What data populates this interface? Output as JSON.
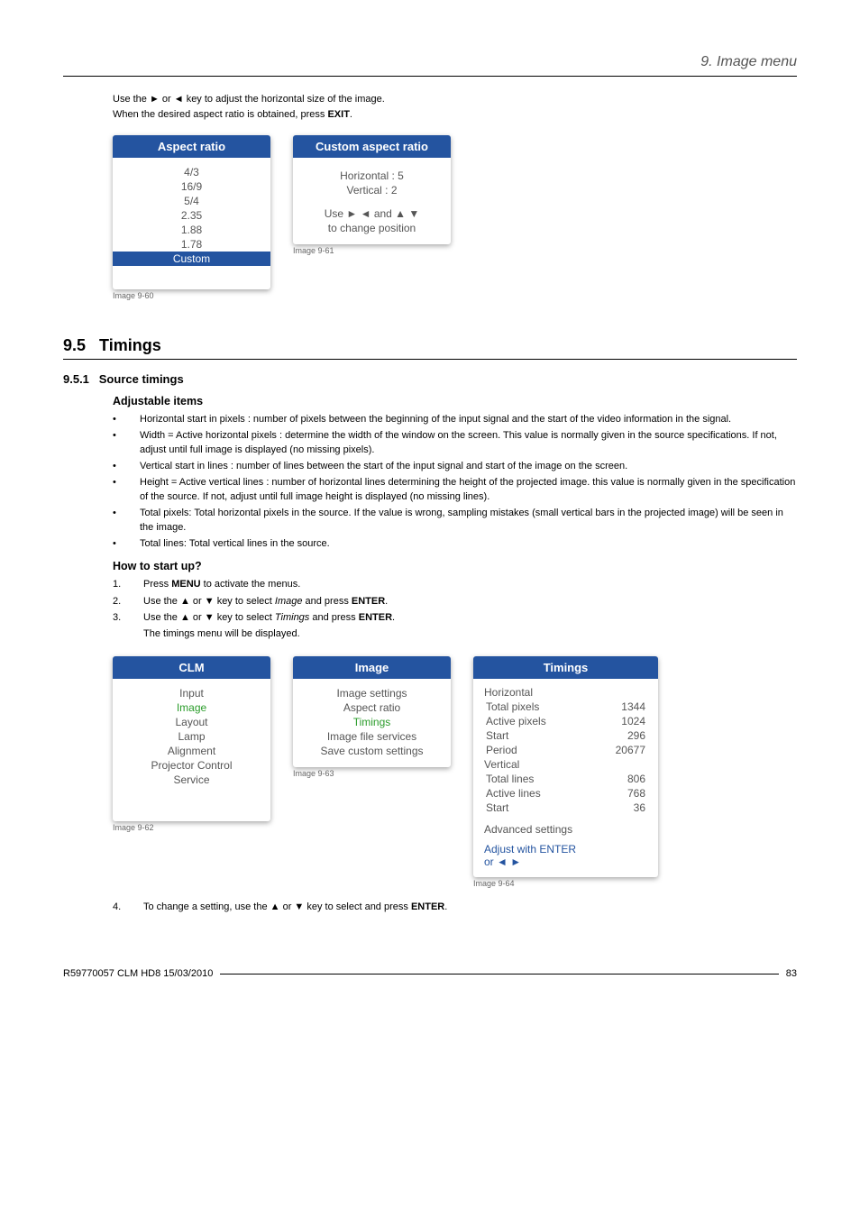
{
  "chapter": "9. Image menu",
  "intro": {
    "line1_pre": "Use the ► or ◄ key to adjust the horizontal size of the image.",
    "line2_pre": "When the desired aspect ratio is obtained, press ",
    "line2_bold": "EXIT",
    "line2_post": "."
  },
  "aspect_box": {
    "title": "Aspect ratio",
    "items": [
      "4/3",
      "16/9",
      "5/4",
      "2.35",
      "1.88",
      "1.78"
    ],
    "selected": "Custom",
    "caption": "Image 9-60"
  },
  "custom_box": {
    "title": "Custom aspect ratio",
    "h_label": "Horizontal : 5",
    "v_label": "Vertical : 2",
    "hint1": "Use ► ◄ and ▲ ▼",
    "hint2": "to change position",
    "caption": "Image 9-61"
  },
  "section_num": "9.5",
  "section_title": "Timings",
  "subsection_num": "9.5.1",
  "subsection_title": "Source timings",
  "adj_heading": "Adjustable items",
  "adj_items": [
    "Horizontal start in pixels : number of pixels between the beginning of the input signal and the start of the video information in the signal.",
    "Width = Active horizontal pixels : determine the width of the window on the screen. This value is normally given in the source specifications. If not, adjust until full image is displayed (no missing pixels).",
    "Vertical start in lines : number of lines between the start of the input signal and start of the image on the screen.",
    "Height = Active vertical lines : number of horizontal lines determining the height of the projected image. this value is normally given in the specification of the source. If not, adjust until full image height is displayed (no missing lines).",
    "Total pixels: Total horizontal pixels in the source. If the value is wrong, sampling mistakes (small vertical bars in the projected image) will be seen in the image.",
    "Total lines: Total vertical lines in the source."
  ],
  "how_heading": "How to start up?",
  "steps": {
    "s1_pre": "Press ",
    "s1_b1": "MENU",
    "s1_post": " to activate the menus.",
    "s2_pre": "Use the ▲ or ▼ key to select ",
    "s2_i": "Image",
    "s2_mid": " and press ",
    "s2_b": "ENTER",
    "s2_post": ".",
    "s3_pre": "Use the ▲ or ▼ key to select ",
    "s3_i": "Timings",
    "s3_mid": " and press ",
    "s3_b": "ENTER",
    "s3_post": ".",
    "s3_note": "The timings menu will be displayed.",
    "s4_pre": "To change a setting, use the ▲ or ▼ key to select and press ",
    "s4_b": "ENTER",
    "s4_post": "."
  },
  "clm_box": {
    "title": "CLM",
    "items": [
      "Input",
      "Image",
      "Layout",
      "Lamp",
      "Alignment",
      "Projector Control",
      "Service"
    ],
    "highlight": "Image",
    "caption": "Image 9-62"
  },
  "image_box": {
    "title": "Image",
    "items": [
      "Image settings",
      "Aspect ratio",
      "Timings",
      "Image file services",
      "Save custom settings"
    ],
    "highlight": "Timings",
    "caption": "Image 9-63"
  },
  "timings_box": {
    "title": "Timings",
    "horizontal_label": "Horizontal",
    "h_rows": [
      {
        "k": "Total pixels",
        "v": "1344"
      },
      {
        "k": "Active pixels",
        "v": "1024"
      },
      {
        "k": "Start",
        "v": "296"
      },
      {
        "k": "Period",
        "v": "20677"
      }
    ],
    "vertical_label": "Vertical",
    "v_rows": [
      {
        "k": "Total lines",
        "v": "806"
      },
      {
        "k": "Active lines",
        "v": "768"
      },
      {
        "k": "Start",
        "v": "36"
      }
    ],
    "advanced": "Advanced settings",
    "adjust1": "Adjust with ENTER",
    "adjust2": "or ◄ ►",
    "caption": "Image 9-64"
  },
  "footer_left": "R59770057  CLM HD8  15/03/2010",
  "footer_right": "83"
}
